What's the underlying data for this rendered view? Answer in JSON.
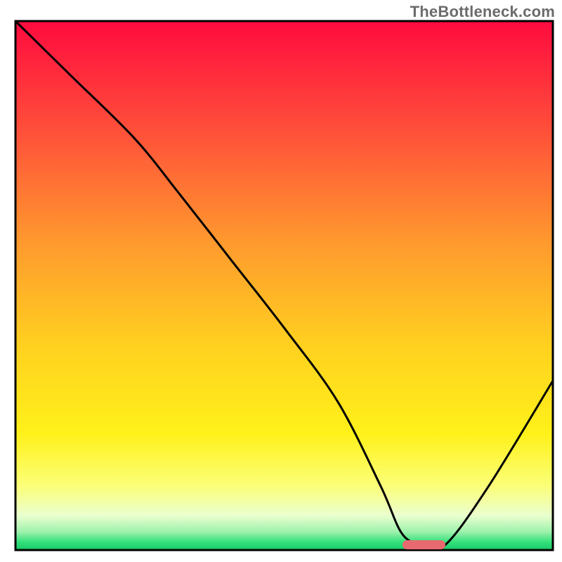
{
  "watermark": "TheBottleneck.com",
  "colors": {
    "stroke": "#000000",
    "marker": "#e66a6f",
    "gradient_stops": [
      {
        "offset": 0.0,
        "color": "#ff0b3f"
      },
      {
        "offset": 0.2,
        "color": "#ff4d3a"
      },
      {
        "offset": 0.42,
        "color": "#ff9a2e"
      },
      {
        "offset": 0.62,
        "color": "#ffd21f"
      },
      {
        "offset": 0.78,
        "color": "#fff11a"
      },
      {
        "offset": 0.88,
        "color": "#fbff7a"
      },
      {
        "offset": 0.935,
        "color": "#eaffcf"
      },
      {
        "offset": 0.965,
        "color": "#9ff2ad"
      },
      {
        "offset": 0.985,
        "color": "#33e07a"
      },
      {
        "offset": 1.0,
        "color": "#18c96a"
      }
    ]
  },
  "chart_data": {
    "type": "line",
    "title": "",
    "xlabel": "",
    "ylabel": "",
    "xlim": [
      0,
      100
    ],
    "ylim": [
      0,
      100
    ],
    "grid": false,
    "legend": false,
    "series": [
      {
        "name": "bottleneck-curve",
        "x": [
          0,
          10,
          22,
          30,
          40,
          50,
          60,
          68,
          72,
          76,
          80,
          88,
          100
        ],
        "y": [
          100,
          90,
          78,
          68,
          55,
          42,
          28,
          12,
          3,
          1,
          1,
          12,
          32
        ]
      }
    ],
    "marker": {
      "name": "optimal-range",
      "x_start": 72,
      "x_end": 80,
      "y": 1
    }
  }
}
